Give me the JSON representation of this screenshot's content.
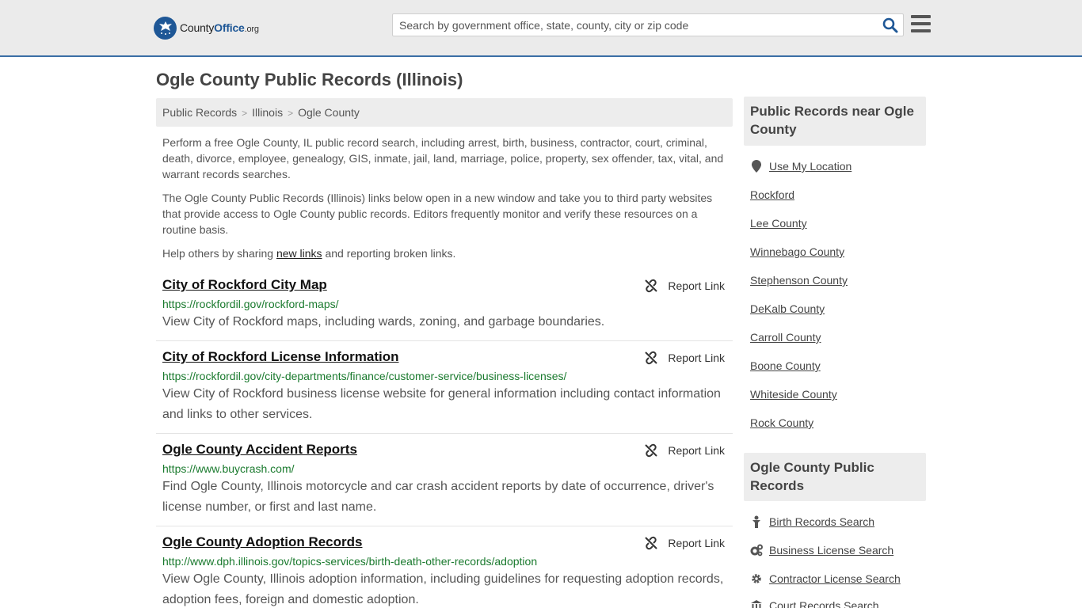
{
  "header": {
    "logo_county": "County",
    "logo_office": "Office",
    "logo_org": ".org",
    "search_placeholder": "Search by government office, state, county, city or zip code"
  },
  "page_title": "Ogle County Public Records (Illinois)",
  "breadcrumb": [
    "Public Records",
    "Illinois",
    "Ogle County"
  ],
  "intro": {
    "p1": "Perform a free Ogle County, IL public record search, including arrest, birth, business, contractor, court, criminal, death, divorce, employee, genealogy, GIS, inmate, jail, land, marriage, police, property, sex offender, tax, vital, and warrant records searches.",
    "p2": "The Ogle County Public Records (Illinois) links below open in a new window and take you to third party websites that provide access to Ogle County public records. Editors frequently monitor and verify these resources on a routine basis.",
    "p3_before": "Help others by sharing ",
    "p3_link": "new links",
    "p3_after": " and reporting broken links."
  },
  "report_label": "Report Link",
  "records": [
    {
      "title": "City of Rockford City Map",
      "url": "https://rockfordil.gov/rockford-maps/",
      "desc": "View City of Rockford maps, including wards, zoning, and garbage boundaries."
    },
    {
      "title": "City of Rockford License Information",
      "url": "https://rockfordil.gov/city-departments/finance/customer-service/business-licenses/",
      "desc": "View City of Rockford business license website for general information including contact information and links to other services."
    },
    {
      "title": "Ogle County Accident Reports",
      "url": "https://www.buycrash.com/",
      "desc": "Find Ogle County, Illinois motorcycle and car crash accident reports by date of occurrence, driver's license number, or first and last name."
    },
    {
      "title": "Ogle County Adoption Records",
      "url": "http://www.dph.illinois.gov/topics-services/birth-death-other-records/adoption",
      "desc": "View Ogle County, Illinois adoption information, including guidelines for requesting adoption records, adoption fees, foreign and domestic adoption."
    }
  ],
  "sidebar": {
    "near_title": "Public Records near Ogle County",
    "use_location": "Use My Location",
    "near_links": [
      "Rockford",
      "Lee County",
      "Winnebago County",
      "Stephenson County",
      "DeKalb County",
      "Carroll County",
      "Boone County",
      "Whiteside County",
      "Rock County"
    ],
    "records_title": "Ogle County Public Records",
    "record_links": [
      {
        "label": "Birth Records Search",
        "icon": "baby-icon"
      },
      {
        "label": "Business License Search",
        "icon": "gears-icon"
      },
      {
        "label": "Contractor License Search",
        "icon": "gear-icon"
      },
      {
        "label": "Court Records Search",
        "icon": "courthouse-icon"
      }
    ]
  },
  "colors": {
    "brand_blue": "#1e5796",
    "url_green": "#1a7a2e",
    "header_bg": "#ebebeb"
  }
}
